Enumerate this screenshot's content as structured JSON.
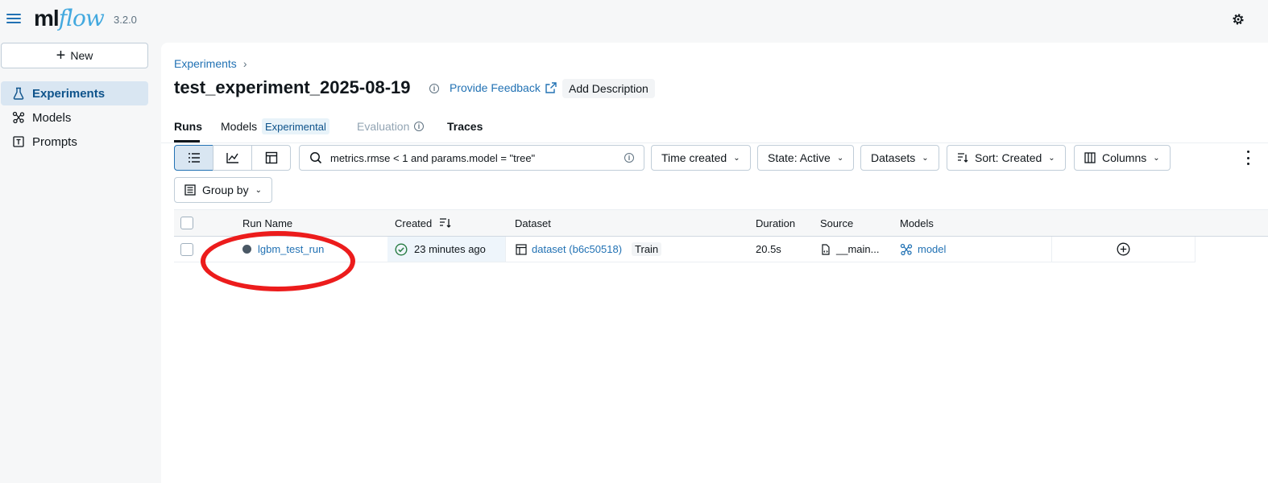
{
  "app": {
    "logo_ml": "ml",
    "logo_flow": "flow",
    "version": "3.2.0"
  },
  "sidebar": {
    "new_label": "New",
    "items": [
      {
        "label": "Experiments",
        "icon": "beaker-icon",
        "active": true
      },
      {
        "label": "Models",
        "icon": "models-icon",
        "active": false
      },
      {
        "label": "Prompts",
        "icon": "prompts-icon",
        "active": false
      }
    ]
  },
  "header": {
    "breadcrumb": "Experiments",
    "breadcrumb_sep": "›",
    "title": "test_experiment_2025-08-19",
    "feedback_label": "Provide Feedback",
    "add_description_label": "Add Description"
  },
  "tabs": {
    "runs": "Runs",
    "models": "Models",
    "models_badge": "Experimental",
    "evaluation": "Evaluation",
    "traces": "Traces"
  },
  "toolbar": {
    "search_value": "metrics.rmse < 1 and params.model = \"tree\"",
    "time_created": "Time created",
    "state": "State: Active",
    "datasets": "Datasets",
    "sort": "Sort: Created",
    "columns": "Columns",
    "group_by": "Group by"
  },
  "table": {
    "headers": {
      "run_name": "Run Name",
      "created": "Created",
      "dataset": "Dataset",
      "duration": "Duration",
      "source": "Source",
      "models": "Models"
    },
    "rows": [
      {
        "run_name": "lgbm_test_run",
        "created": "23 minutes ago",
        "dataset": "dataset (b6c50518)",
        "dataset_tag": "Train",
        "duration": "20.5s",
        "source": "__main...",
        "model": "model"
      }
    ]
  },
  "colors": {
    "accent": "#2272b4",
    "annotation": "#ec1c1c",
    "success": "#277c43"
  }
}
